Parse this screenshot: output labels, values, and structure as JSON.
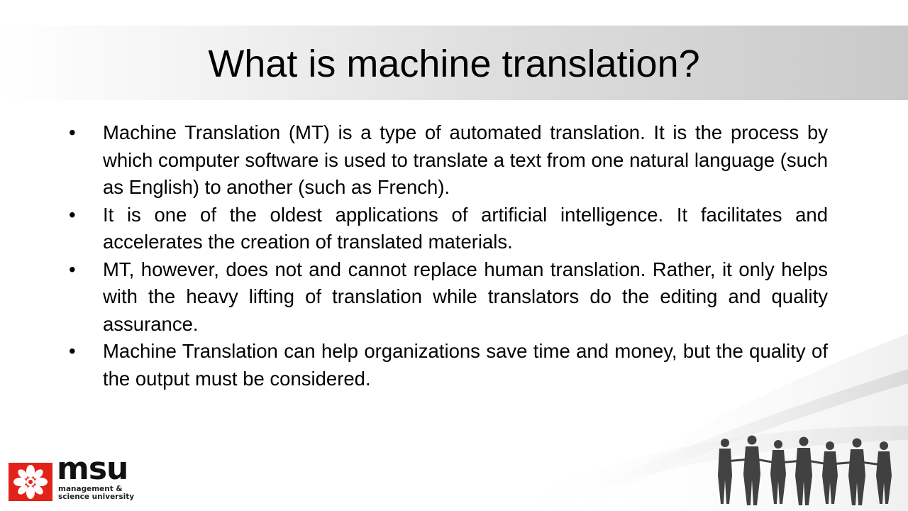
{
  "slide": {
    "title": "What is machine translation?",
    "bullet_symbol": "•",
    "bullets": [
      "Machine Translation (MT) is a type of automated translation. It is the process by which computer software is used to translate a text from one natural language (such as English) to another (such as French).",
      "It is one of the oldest applications of artificial intelligence. It facilitates and accelerates the creation of translated materials.",
      "MT, however, does not and cannot replace human translation. Rather, it only helps with the heavy lifting of translation while translators do the editing and quality assurance.",
      "Machine Translation can help organizations save time and money, but the quality of the output must be considered."
    ]
  },
  "logo": {
    "wordmark": "msu",
    "line1": "management &",
    "line2": "science university",
    "emblem_icon": "red-flower-emblem-icon",
    "emblem_color": "#e2231a"
  },
  "decoration": {
    "people_icon": "people-holding-hands-silhouette-icon"
  }
}
